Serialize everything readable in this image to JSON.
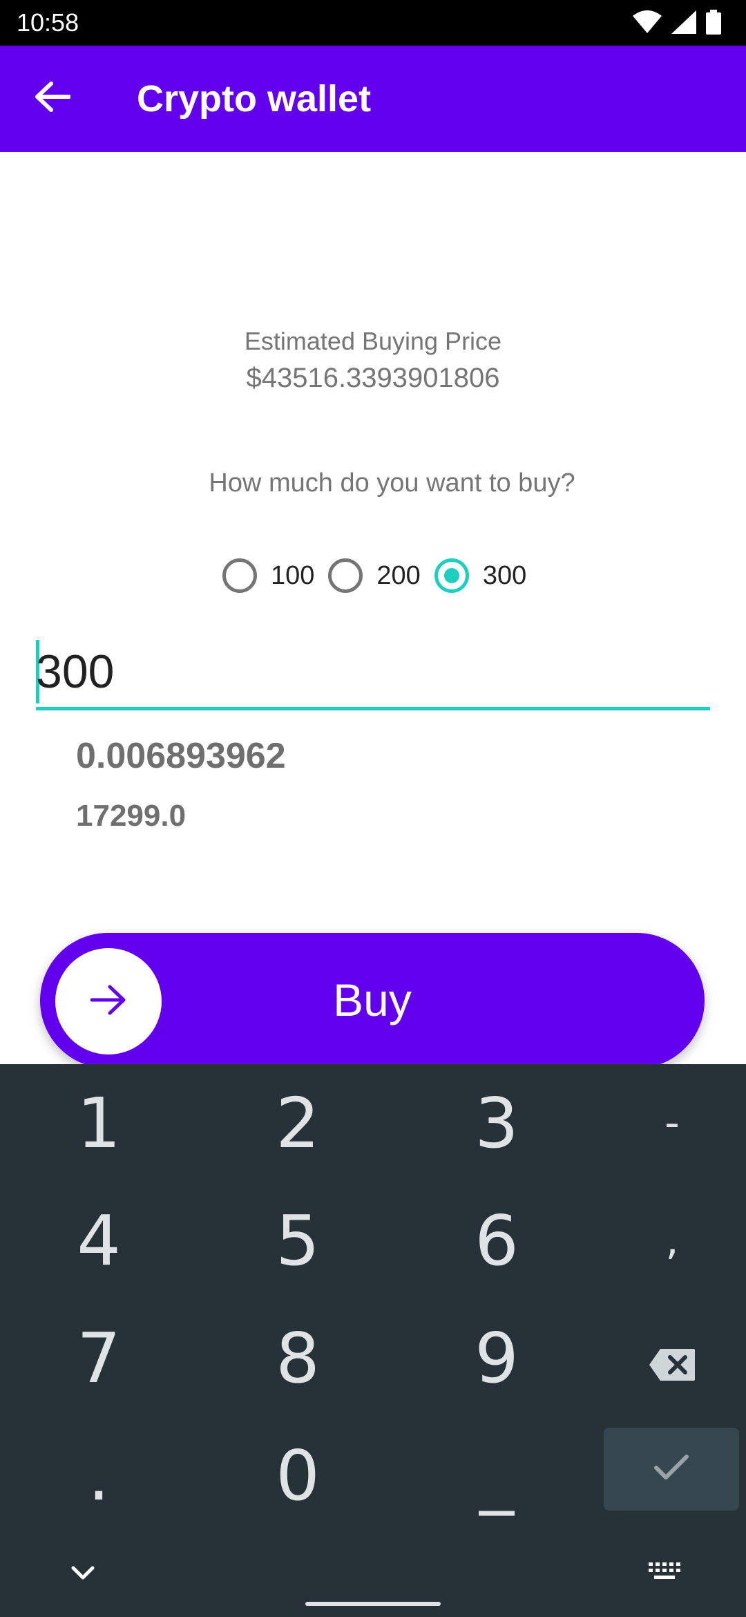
{
  "status_bar": {
    "time": "10:58",
    "icons": [
      "wifi-icon",
      "signal-icon",
      "battery-icon"
    ]
  },
  "app_bar": {
    "title": "Crypto wallet",
    "back_icon": "arrow-left-icon",
    "background": "#6200EE"
  },
  "price": {
    "label": "Estimated Buying Price",
    "value": "$43516.3393901806"
  },
  "question": "How much do you want to buy?",
  "options": [
    {
      "label": "100",
      "checked": false
    },
    {
      "label": "200",
      "checked": false
    },
    {
      "label": "300",
      "checked": true
    }
  ],
  "amount_input": {
    "value": "300",
    "accent": "#1ECFC0"
  },
  "results": {
    "crypto_amount": "0.006893962",
    "secondary_amount": "17299.0"
  },
  "buy_button": {
    "label": "Buy",
    "icon": "arrow-right-icon"
  },
  "keyboard": {
    "rows": [
      [
        "1",
        "2",
        "3",
        "-"
      ],
      [
        "4",
        "5",
        "6",
        ","
      ],
      [
        "7",
        "8",
        "9",
        "backspace-icon"
      ],
      [
        ".",
        "0",
        "_",
        "check-icon"
      ]
    ],
    "hide_icon": "chevron-down-icon",
    "switch_icon": "keyboard-icon"
  }
}
